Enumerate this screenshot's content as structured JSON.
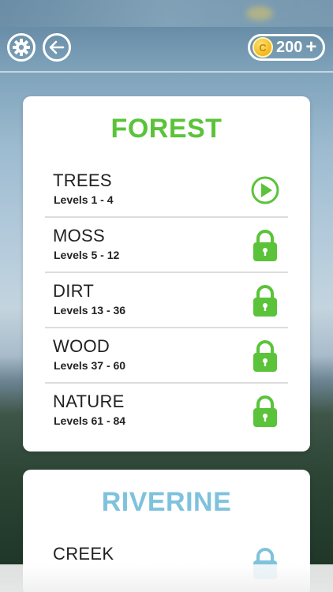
{
  "header": {
    "settings_icon": "gear-icon",
    "back_icon": "back-arrow-icon",
    "coin_symbol": "C",
    "coins": "200",
    "add_label": "+"
  },
  "colors": {
    "forest_title": "#5ac33a",
    "riverine_title": "#7ec2dc",
    "unlocked_green": "#5ac33a",
    "locked_green": "#5ac33a",
    "locked_blue": "#7ec2dc"
  },
  "packs": [
    {
      "title": "FOREST",
      "rows": [
        {
          "name": "TREES",
          "levels": "Levels 1 - 4",
          "status": "play"
        },
        {
          "name": "MOSS",
          "levels": "Levels 5 - 12",
          "status": "locked"
        },
        {
          "name": "DIRT",
          "levels": "Levels 13 - 36",
          "status": "locked"
        },
        {
          "name": "WOOD",
          "levels": "Levels 37 - 60",
          "status": "locked"
        },
        {
          "name": "NATURE",
          "levels": "Levels 61 - 84",
          "status": "locked"
        }
      ]
    },
    {
      "title": "RIVERINE",
      "rows": [
        {
          "name": "CREEK",
          "levels": "",
          "status": "locked"
        }
      ]
    }
  ]
}
